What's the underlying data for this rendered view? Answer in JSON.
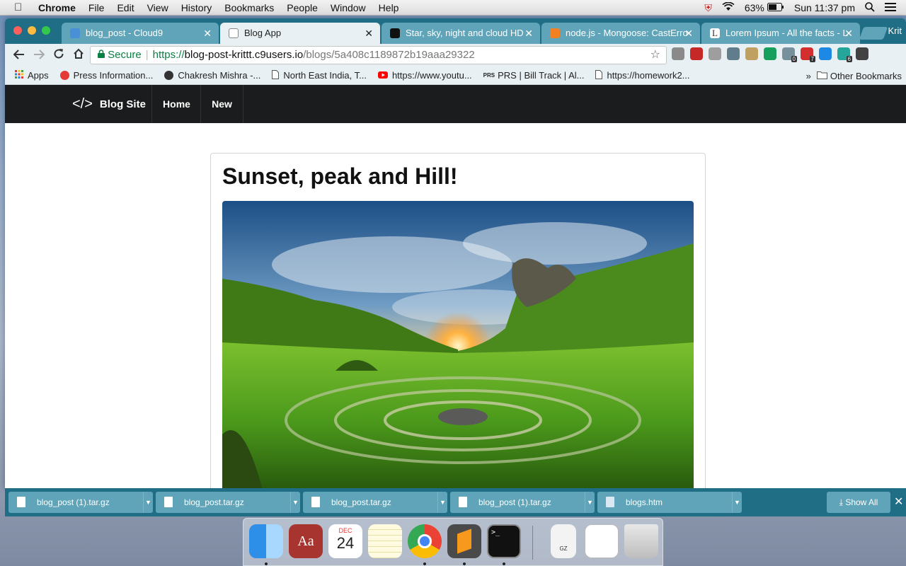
{
  "menubar": {
    "items": [
      "Chrome",
      "File",
      "Edit",
      "View",
      "History",
      "Bookmarks",
      "People",
      "Window",
      "Help"
    ],
    "battery": "63%",
    "clock": "Sun 11:37 pm"
  },
  "tabs": [
    {
      "title": "blog_post - Cloud9",
      "favicon_color": "#4a90d9",
      "active": false
    },
    {
      "title": "Blog App",
      "favicon_color": "#ffffff",
      "active": true
    },
    {
      "title": "Star, sky, night and cloud HD",
      "favicon_color": "#111111",
      "active": false
    },
    {
      "title": "node.js - Mongoose: CastErro",
      "favicon_color": "#f48024",
      "active": false
    },
    {
      "title": "Lorem Ipsum - All the facts - L",
      "favicon_color": "#333333",
      "active": false
    }
  ],
  "profile_name": "Krit",
  "omnibox": {
    "secure_label": "Secure",
    "protocol": "https://",
    "host": "blog-post-krittt.c9users.io",
    "path": "/blogs/5a408c1189872b19aaa29322"
  },
  "extensions": [
    {
      "name": "ext-1-icon",
      "color": "#8a8a8a"
    },
    {
      "name": "ext-2-icon",
      "color": "#c62828"
    },
    {
      "name": "ext-3-icon",
      "color": "#9e9e9e"
    },
    {
      "name": "ext-4-icon",
      "color": "#607d8b"
    },
    {
      "name": "ext-5-icon",
      "color": "#c0a060"
    },
    {
      "name": "ext-6-icon",
      "color": "#17a05d"
    },
    {
      "name": "ext-7-icon",
      "color": "#78909c",
      "badge": "0"
    },
    {
      "name": "ext-8-icon",
      "color": "#d32f2f",
      "badge": "7"
    },
    {
      "name": "ext-9-icon",
      "color": "#1e88e5"
    },
    {
      "name": "ext-10-icon",
      "color": "#26a69a",
      "badge": "6"
    },
    {
      "name": "ext-11-icon",
      "color": "#424242"
    }
  ],
  "bookmarks": [
    {
      "label": "Apps",
      "icon_color": "#e53935"
    },
    {
      "label": "Press Information...",
      "icon_color": "#e53935"
    },
    {
      "label": "Chakresh Mishra -...",
      "icon_color": "#333333"
    },
    {
      "label": "North East India, T...",
      "icon_color": "#9e9e9e"
    },
    {
      "label": "https://www.youtu...",
      "icon_color": "#ff0000"
    },
    {
      "label": "PRS | Bill Track | Al...",
      "icon_color": "#333333"
    },
    {
      "label": "https://homework2...",
      "icon_color": "#9e9e9e"
    }
  ],
  "bookmarks_more": "»",
  "other_bookmarks": "Other Bookmarks",
  "site": {
    "brand": "Blog Site",
    "brand_glyph": "</>",
    "nav": [
      "Home",
      "New"
    ]
  },
  "post": {
    "title": "Sunset, peak and Hill!"
  },
  "downloads": [
    "blog_post (1).tar.gz",
    "blog_post.tar.gz",
    "blog_post.tar.gz",
    "blog_post (1).tar.gz",
    "blogs.htm"
  ],
  "show_all": "Show All",
  "dock": {
    "calendar_month": "DEC",
    "calendar_day": "24",
    "dictionary_glyph": "Aa",
    "archive_label": "GZ"
  }
}
